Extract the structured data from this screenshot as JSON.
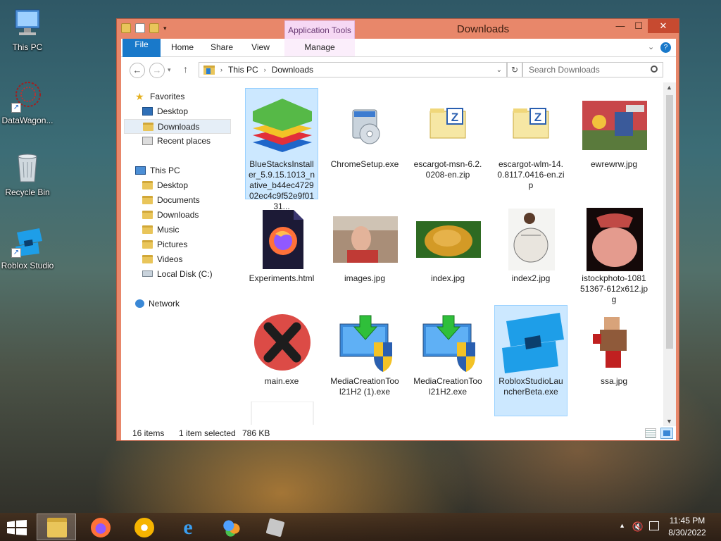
{
  "desktop": {
    "icons": [
      {
        "label": "This PC"
      },
      {
        "label": "DataWagon..."
      },
      {
        "label": "Recycle Bin"
      },
      {
        "label": "Roblox Studio"
      }
    ]
  },
  "window": {
    "context_tab": "Application Tools",
    "title": "Downloads",
    "ribbon_tabs": [
      "File",
      "Home",
      "Share",
      "View",
      "Manage"
    ],
    "breadcrumb": [
      "This PC",
      "Downloads"
    ],
    "search_placeholder": "Search Downloads",
    "nav": {
      "favorites": {
        "label": "Favorites",
        "items": [
          "Desktop",
          "Downloads",
          "Recent places"
        ],
        "selected": "Downloads"
      },
      "this_pc": {
        "label": "This PC",
        "items": [
          "Desktop",
          "Documents",
          "Downloads",
          "Music",
          "Pictures",
          "Videos",
          "Local Disk (C:)"
        ]
      },
      "network": "Network"
    },
    "files": [
      {
        "name": "BlueStacksInstaller_5.9.15.1013_native_b44ec472902ec4c9f52e9f0131...",
        "icon": "bluestacks-icon",
        "selected": true
      },
      {
        "name": "ChromeSetup.exe",
        "icon": "installer-icon",
        "selected": false
      },
      {
        "name": "escargot-msn-6.2.0208-en.zip",
        "icon": "zip-folder-icon",
        "selected": false
      },
      {
        "name": "escargot-wlm-14.0.8117.0416-en.zip",
        "icon": "zip-folder-icon",
        "selected": false
      },
      {
        "name": "ewrewrw.jpg",
        "icon": "image-thumbnail",
        "selected": false
      },
      {
        "name": "Experiments.html",
        "icon": "firefox-document-icon",
        "selected": false
      },
      {
        "name": "images.jpg",
        "icon": "image-thumbnail",
        "selected": false
      },
      {
        "name": "index.jpg",
        "icon": "image-thumbnail",
        "selected": false
      },
      {
        "name": "index2.jpg",
        "icon": "image-thumbnail",
        "selected": false
      },
      {
        "name": "istockphoto-108151367-612x612.jpg",
        "icon": "image-thumbnail",
        "selected": false
      },
      {
        "name": "main.exe",
        "icon": "red-x-icon",
        "selected": false
      },
      {
        "name": "MediaCreationTool21H2 (1).exe",
        "icon": "media-creation-tool-icon",
        "selected": false
      },
      {
        "name": "MediaCreationTool21H2.exe",
        "icon": "media-creation-tool-icon",
        "selected": false
      },
      {
        "name": "RobloxStudioLauncherBeta.exe",
        "icon": "roblox-studio-icon",
        "selected": true
      },
      {
        "name": "ssa.jpg",
        "icon": "image-thumbnail",
        "selected": false
      },
      {
        "name": "",
        "icon": "blank-file-icon",
        "selected": false
      }
    ],
    "status": {
      "count": "16 items",
      "selection": "1 item selected",
      "size": "786 KB"
    }
  },
  "taskbar": {
    "apps": [
      "start-icon",
      "file-explorer-icon",
      "firefox-icon",
      "chrome-icon",
      "internet-explorer-icon",
      "msn-messenger-icon",
      "roblox-studio-icon"
    ],
    "time": "11:45 PM",
    "date": "8/30/2022"
  },
  "colors": {
    "window_frame": "#e8876a",
    "close_button": "#c74a30",
    "selection": "#cce8ff",
    "file_tab": "#1979ca",
    "context_tab": "#f6d8f4"
  }
}
